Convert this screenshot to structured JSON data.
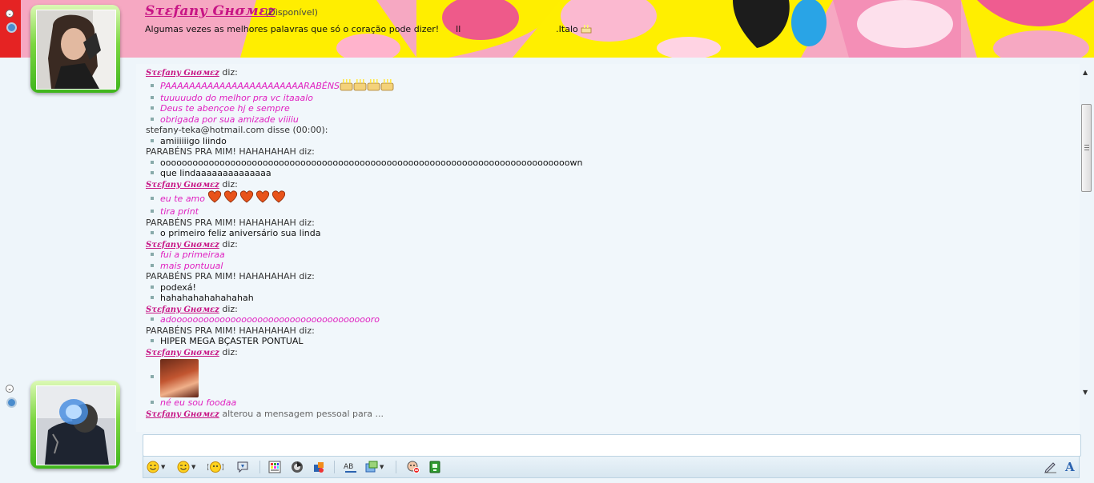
{
  "header": {
    "contact_name": "Sτεfany Gнσмεz",
    "status": "(Disponível)",
    "personal_message": "Algumas vezes as melhores palavras que só o coração pode dizer!      ll                                  .Italo"
  },
  "conversation": {
    "messages": [
      {
        "sender": "Sτεfany Gнσмεz",
        "says": "diz:",
        "styled": true,
        "lines": [
          {
            "text": "PAAAAAAAAAAAAAAAAAAAAAAARABÉNS",
            "color": "pink",
            "emoji": "cakes"
          },
          {
            "text": "tuuuuudo do melhor pra vc itaaalo",
            "color": "pink"
          },
          {
            "text": "Deus te abençoe hj e sempre",
            "color": "pink"
          },
          {
            "text": "obrigada por sua amizade viiiiu",
            "color": "pink"
          }
        ]
      },
      {
        "sender": "stefany-teka@hotmail.com disse (00:00):",
        "says": "",
        "styled": false,
        "lines": [
          {
            "text": "amiiiiiigo liindo",
            "color": "black"
          }
        ]
      },
      {
        "sender": "PARABÉNS PRA MIM! HAHAHAHAH diz:",
        "says": "",
        "styled": false,
        "lines": [
          {
            "text": "oooooooooooooooooooooooooooooooooooooooooooooooooooooooooooooooooooooooooooown",
            "color": "black"
          },
          {
            "text": "que lindaaaaaaaaaaaaaa",
            "color": "black"
          }
        ]
      },
      {
        "sender": "Sτεfany Gнσмεz",
        "says": "diz:",
        "styled": true,
        "lines": [
          {
            "text": "eu te amo",
            "color": "pink",
            "emoji": "hearts"
          },
          {
            "text": "tira print",
            "color": "pink"
          }
        ]
      },
      {
        "sender": "PARABÉNS PRA MIM! HAHAHAHAH diz:",
        "says": "",
        "styled": false,
        "lines": [
          {
            "text": "o primeiro feliz aniversário sua linda",
            "color": "black"
          }
        ]
      },
      {
        "sender": "Sτεfany Gнσмεz",
        "says": "diz:",
        "styled": true,
        "lines": [
          {
            "text": "fui a primeiraa",
            "color": "pink"
          },
          {
            "text": "mais pontuual",
            "color": "pink"
          }
        ]
      },
      {
        "sender": "PARABÉNS PRA MIM! HAHAHAHAH diz:",
        "says": "",
        "styled": false,
        "lines": [
          {
            "text": "podexá!",
            "color": "black"
          },
          {
            "text": "hahahahahahahahah",
            "color": "black"
          }
        ]
      },
      {
        "sender": "Sτεfany Gнσмεz",
        "says": "diz:",
        "styled": true,
        "lines": [
          {
            "text": "adoooooooooooooooooooooooooooooooooooooro",
            "color": "pink"
          }
        ]
      },
      {
        "sender": "PARABÉNS PRA MIM! HAHAHAHAH diz:",
        "says": "",
        "styled": false,
        "lines": [
          {
            "text": "HIPER MEGA BÇASTER PONTUAL",
            "color": "black"
          }
        ]
      },
      {
        "sender": "Sτεfany Gнσмεz",
        "says": "diz:",
        "styled": true,
        "lines": [
          {
            "text": "",
            "color": "pink",
            "emoji": "photo"
          },
          {
            "text": "né eu sou foodaa",
            "color": "pink"
          }
        ]
      }
    ],
    "status_event": {
      "sender": "Sτεfany Gнσмεz",
      "text": "alterou a mensagem pessoal para ..."
    }
  },
  "toolbar": {
    "icons": [
      "emoticon-icon",
      "wink-icon",
      "nudge-icon",
      "voice-clip-icon",
      "background-icon",
      "games-icon",
      "activities-icon",
      "text-style-icon",
      "invite-icon",
      "block-icon",
      "mobile-icon"
    ],
    "font_label": "A"
  },
  "colors": {
    "pink_text": "#e020c0",
    "name_color": "#c71585",
    "avatar_frame": "#4fc31f"
  }
}
